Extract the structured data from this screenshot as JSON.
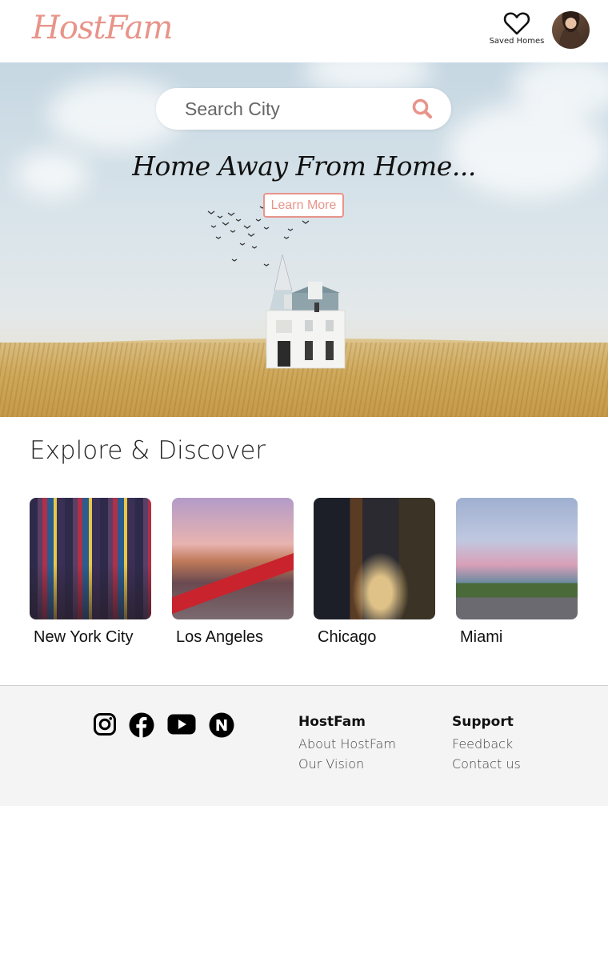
{
  "header": {
    "logo": "HostFam",
    "saved_label": "Saved Homes",
    "saved_icon": "heart-icon",
    "avatar_icon": "user-avatar"
  },
  "hero": {
    "search_placeholder": "Search City",
    "search_icon": "search-icon",
    "tagline": "Home Away From Home...",
    "learn_more": "Learn More"
  },
  "explore": {
    "title": "Explore & Discover",
    "cities": [
      {
        "name": "New York City"
      },
      {
        "name": "Los Angeles"
      },
      {
        "name": "Chicago"
      },
      {
        "name": "Miami"
      }
    ]
  },
  "footer": {
    "social_icons": [
      "instagram-icon",
      "facebook-icon",
      "youtube-icon",
      "news-n-icon"
    ],
    "col1": {
      "heading": "HostFam",
      "links": [
        "About HostFam",
        "Our Vision"
      ]
    },
    "col2": {
      "heading": "Support",
      "links": [
        "Feedback",
        "Contact us"
      ]
    }
  },
  "colors": {
    "accent": "#e8948a",
    "footer_bg": "#f4f4f4"
  }
}
